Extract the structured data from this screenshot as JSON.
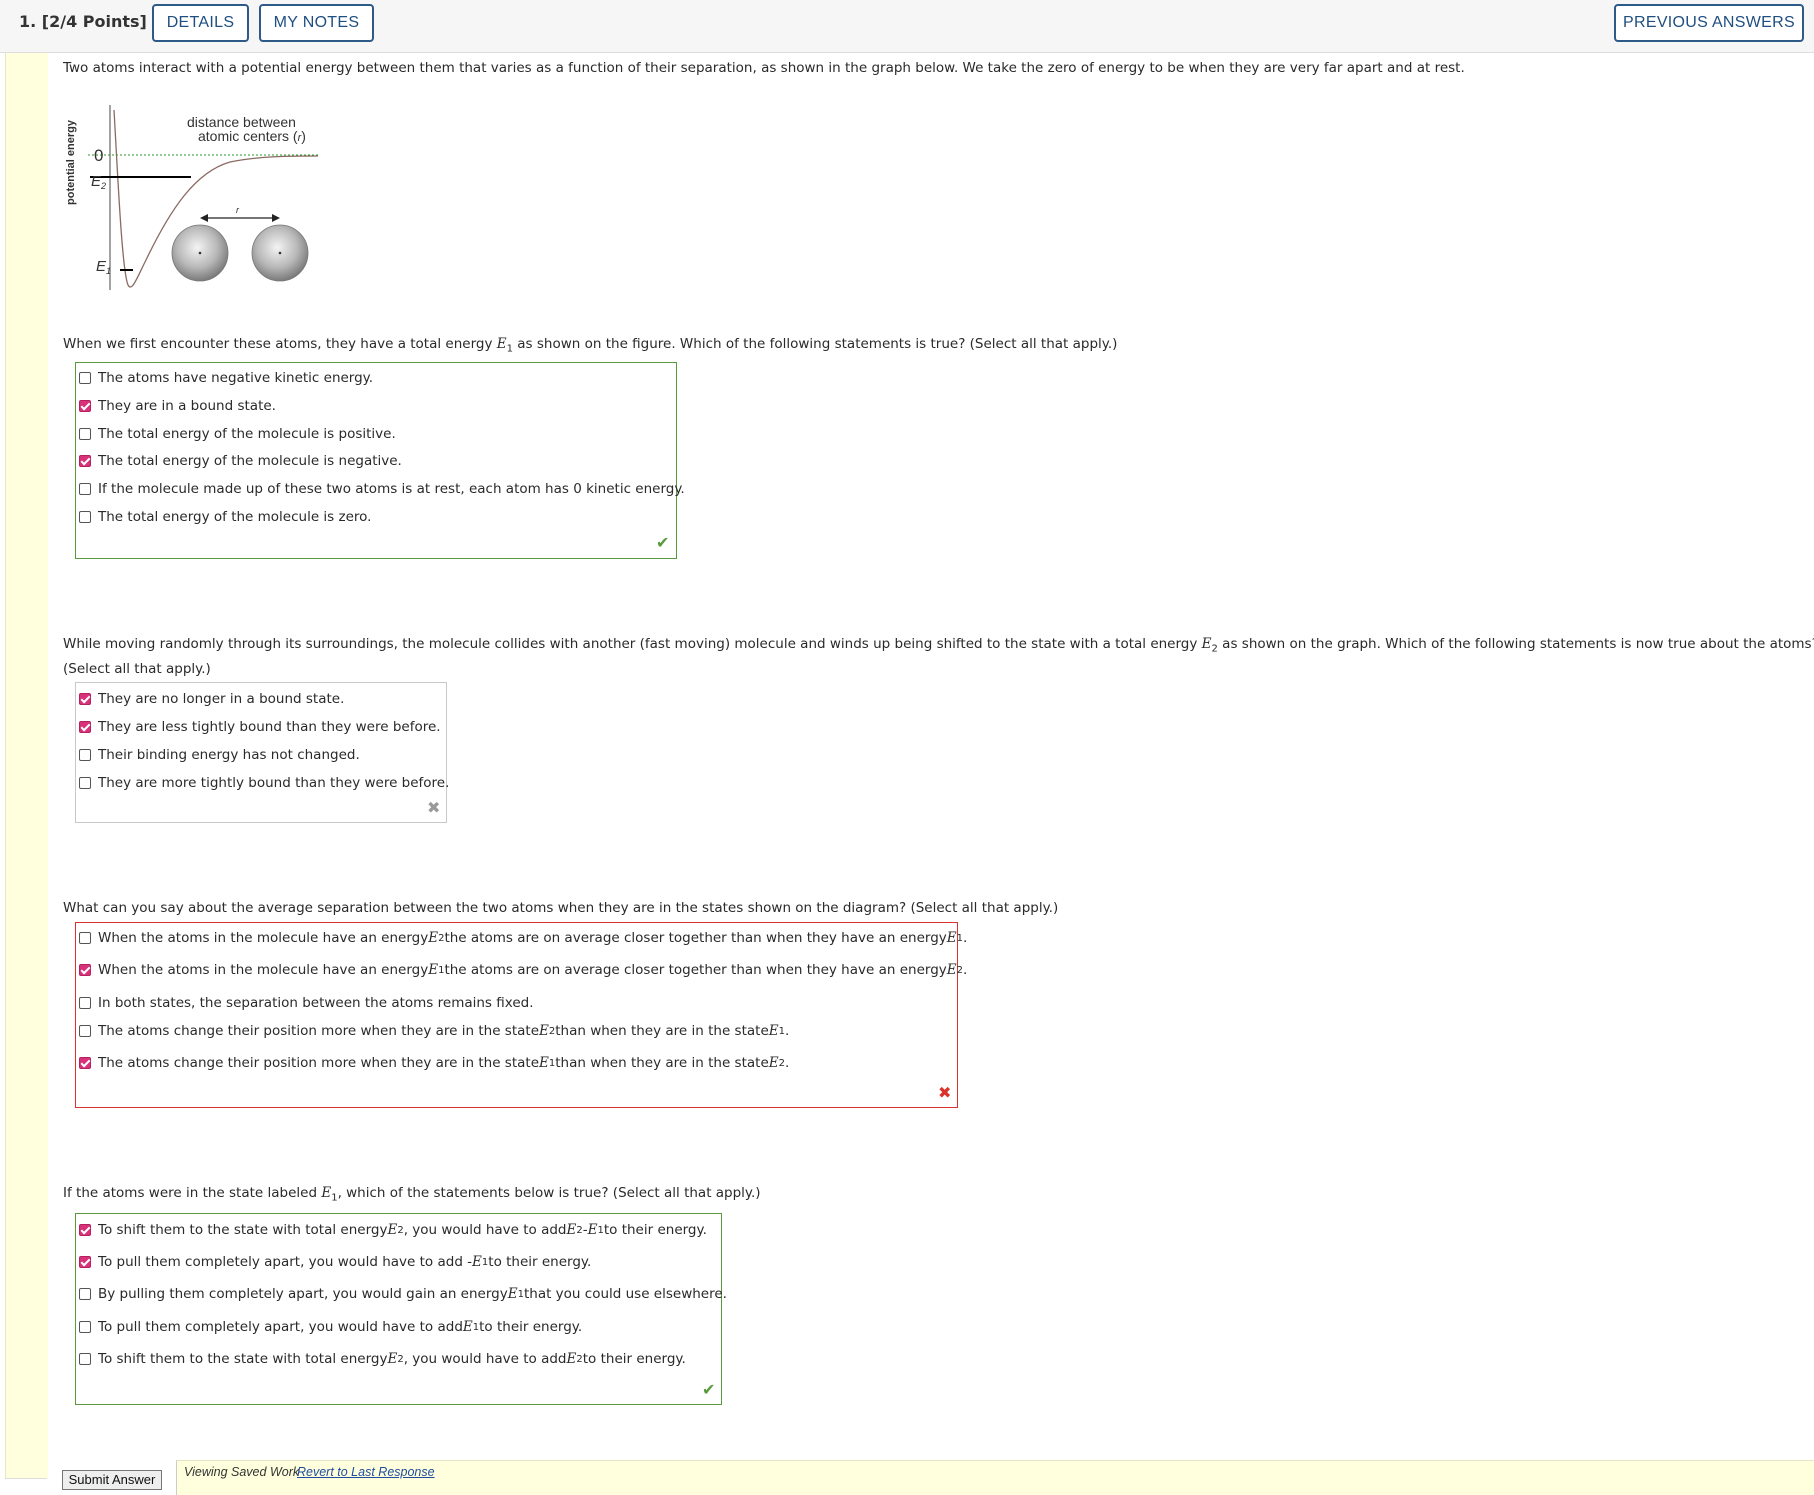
{
  "header": {
    "question_number": "1.",
    "points": "[2/4 Points]",
    "details_label": "DETAILS",
    "notes_label": "MY NOTES",
    "previous_label": "PREVIOUS ANSWERS"
  },
  "intro": "Two atoms interact with a potential energy between them that varies as a function of their separation, as shown in the graph below. We take the zero of energy to be when they are very far apart and at rest.",
  "figure": {
    "ylabel": "potential energy",
    "zero": "0",
    "e2": "E",
    "e2_sub": "2",
    "e1": "E",
    "e1_sub": "1",
    "xlabel_line1": "distance between",
    "xlabel_line2": "atomic centers (",
    "xlabel_var": "r",
    "xlabel_end": ")",
    "arrow_label": "r"
  },
  "q1": {
    "prompt_a": "When we first encounter these atoms, they have a total energy ",
    "prompt_b": " as shown on the figure. Which of the following statements is true? (Select all that apply.)",
    "options": [
      {
        "label": "The atoms have negative kinetic energy.",
        "checked": false
      },
      {
        "label": "They are in a bound state.",
        "checked": true
      },
      {
        "label": "The total energy of the molecule is positive.",
        "checked": false
      },
      {
        "label": "The total energy of the molecule is negative.",
        "checked": true
      },
      {
        "label": "If the molecule made up of these two atoms is at rest, each atom has 0 kinetic energy.",
        "checked": false
      },
      {
        "label": "The total energy of the molecule is zero.",
        "checked": false
      }
    ],
    "result": "correct"
  },
  "q2": {
    "prompt_a": "While moving randomly through its surroundings, the molecule collides with another (fast moving) molecule and winds up being shifted to the state with a total energy ",
    "prompt_b": " as shown on the graph. Which of the following statements is now true about the atoms?",
    "prompt_c": "(Select all that apply.)",
    "options": [
      {
        "label": "They are no longer in a bound state.",
        "checked": true
      },
      {
        "label": "They are less tightly bound than they were before.",
        "checked": true
      },
      {
        "label": "Their binding energy has not changed.",
        "checked": false
      },
      {
        "label": "They are more tightly bound than they were before.",
        "checked": false
      }
    ],
    "result": "incorrect-ungraded"
  },
  "q3": {
    "prompt": "What can you say about the average separation between the two atoms when they are in the states shown on the diagram? (Select all that apply.)",
    "opt1_a": "When the atoms in the molecule have an energy ",
    "opt1_b": " the atoms are on average closer together than when they have an energy ",
    "opt2_a": "When the atoms in the molecule have an energy ",
    "opt2_b": " the atoms are on average closer together than when they have an energy ",
    "opt3": "In both states, the separation between the atoms remains fixed.",
    "opt4_a": "The atoms change their position more when they are in the state ",
    "opt4_b": " than when they are in the state ",
    "opt5_a": "The atoms change their position more when they are in the state ",
    "opt5_b": " than when they are in the state ",
    "checked": [
      false,
      true,
      false,
      false,
      true
    ],
    "result": "incorrect"
  },
  "q4": {
    "prompt_a": "If the atoms were in the state labeled ",
    "prompt_b": ", which of the statements below is true? (Select all that apply.)",
    "opt1_a": "To shift them to the state with total energy ",
    "opt1_b": ", you would have to add ",
    "opt1_c": " - ",
    "opt1_d": " to their energy.",
    "opt2_a": "To pull them completely apart, you would have to add -",
    "opt2_b": " to their energy.",
    "opt3_a": "By pulling them completely apart, you would gain an energy ",
    "opt3_b": " that you could use elsewhere.",
    "opt4_a": "To pull them completely apart, you would have to add ",
    "opt4_b": " to their energy.",
    "opt5_a": "To shift them to the state with total energy ",
    "opt5_b": ", you would have to add ",
    "opt5_c": " to their energy.",
    "checked": [
      true,
      true,
      false,
      false,
      false
    ],
    "result": "correct"
  },
  "footer": {
    "submit_label": "Submit Answer",
    "saved_msg": "Viewing Saved Work",
    "revert_label": "Revert to Last Response"
  },
  "symbols": {
    "E": "E",
    "one": "1",
    "two": "2",
    "period": ".",
    "comma": ","
  },
  "colors": {
    "correct": "#5a9a3c",
    "incorrect": "#d9342b",
    "checked": "#d8337a",
    "accent": "#1f4e80"
  }
}
